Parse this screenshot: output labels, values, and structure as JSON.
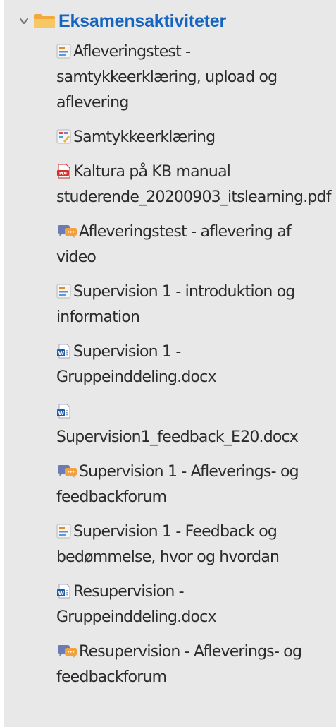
{
  "section": {
    "title": "Eksamensaktiviteter",
    "expanded_icon": "chevron-down-icon",
    "folder_icon": "folder-icon"
  },
  "colors": {
    "title": "#1565c0",
    "panel_bg": "#e8e8e8",
    "text": "#2b2b2b",
    "folder": "#f5b94a",
    "pdf": "#d32f2f",
    "word": "#1e5ba8",
    "forum": "#6b7bb5"
  },
  "items": [
    {
      "icon": "assignment-icon",
      "label": "Afleveringstest - samtykkeerklæring, upload og aflevering"
    },
    {
      "icon": "feedback-icon",
      "label": "Samtykkeerklæring"
    },
    {
      "icon": "pdf-icon",
      "label": "Kaltura på KB manual studerende_20200903_itslearning.pdf"
    },
    {
      "icon": "forum-icon",
      "label": "Afleveringstest - aflevering af video"
    },
    {
      "icon": "assignment-icon",
      "label": "Supervision 1 - introduktion og information"
    },
    {
      "icon": "word-icon",
      "label": "Supervision 1 - Gruppeinddeling.docx"
    },
    {
      "icon": "word-icon",
      "label": "Supervision1_feedback_E20.docx"
    },
    {
      "icon": "forum-icon",
      "label": "Supervision 1 - Afleverings- og feedbackforum"
    },
    {
      "icon": "assignment-icon",
      "label": "Supervision 1 - Feedback og bedømmelse, hvor og hvordan"
    },
    {
      "icon": "word-icon",
      "label": "Resupervision - Gruppeinddeling.docx"
    },
    {
      "icon": "forum-icon",
      "label": "Resupervision - Afleverings- og feedbackforum"
    }
  ]
}
